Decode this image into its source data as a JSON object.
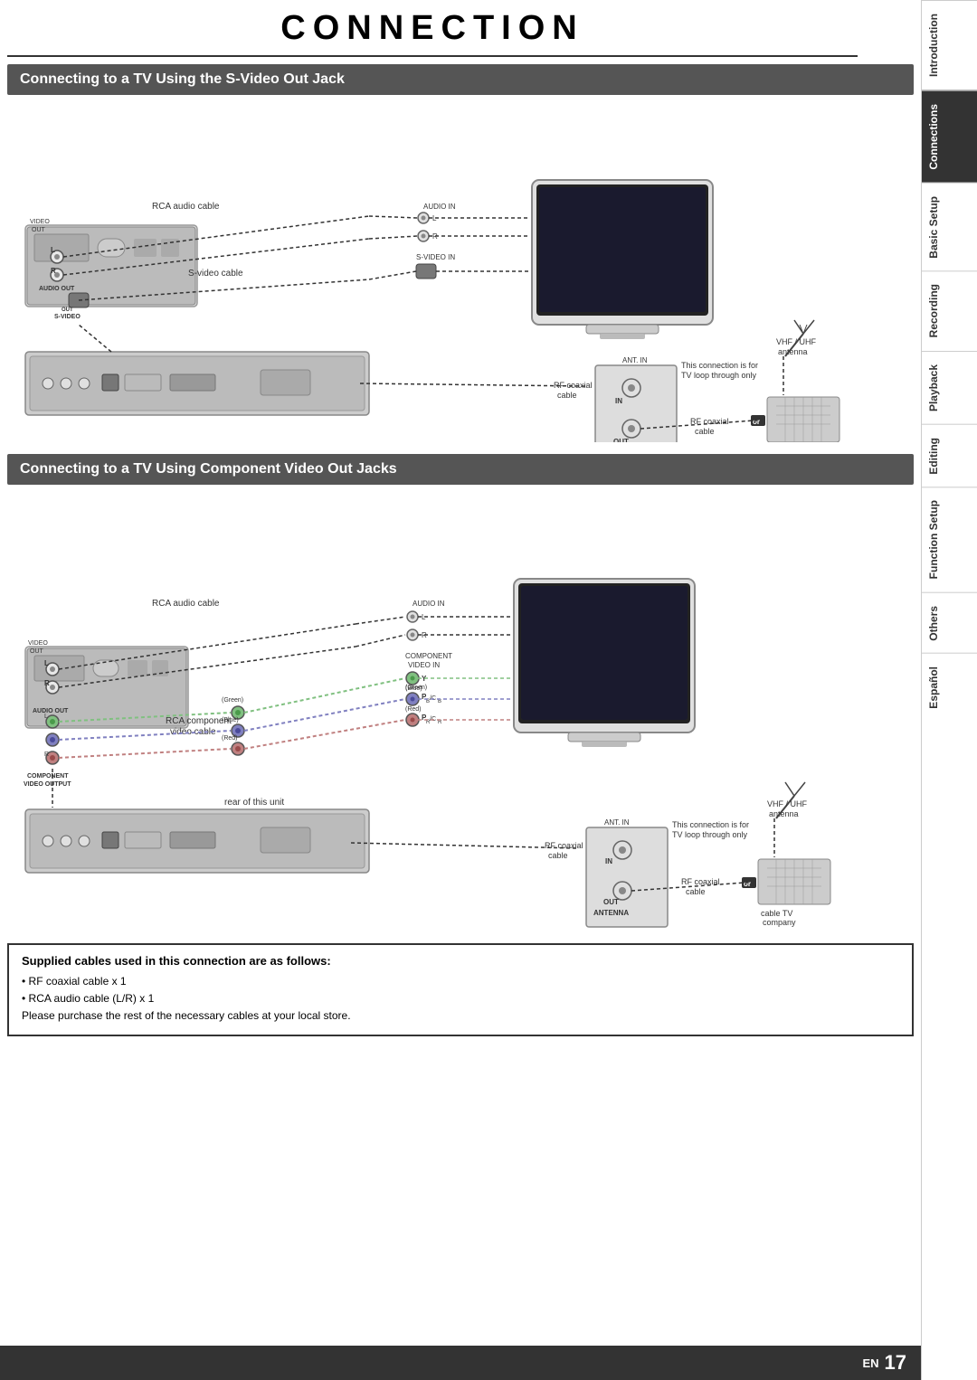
{
  "page": {
    "title": "CONNECTION",
    "section1": {
      "header": "Connecting to a TV Using the S-Video Out Jack"
    },
    "section2": {
      "header": "Connecting to a TV Using Component Video Out Jacks"
    },
    "infoBox": {
      "title": "Supplied cables used in this connection are as follows:",
      "lines": [
        "• RF coaxial cable x 1",
        "• RCA audio cable (L/R) x 1",
        "Please purchase the rest of the necessary cables at your local store."
      ]
    },
    "bottomBar": {
      "lang": "EN",
      "pageNum": "17"
    }
  },
  "sidebar": {
    "items": [
      {
        "label": "Introduction",
        "active": false
      },
      {
        "label": "Connections",
        "active": true
      },
      {
        "label": "Basic Setup",
        "active": false
      },
      {
        "label": "Recording",
        "active": false
      },
      {
        "label": "Playback",
        "active": false
      },
      {
        "label": "Editing",
        "active": false
      },
      {
        "label": "Function Setup",
        "active": false
      },
      {
        "label": "Others",
        "active": false
      },
      {
        "label": "Español",
        "active": false
      }
    ]
  }
}
